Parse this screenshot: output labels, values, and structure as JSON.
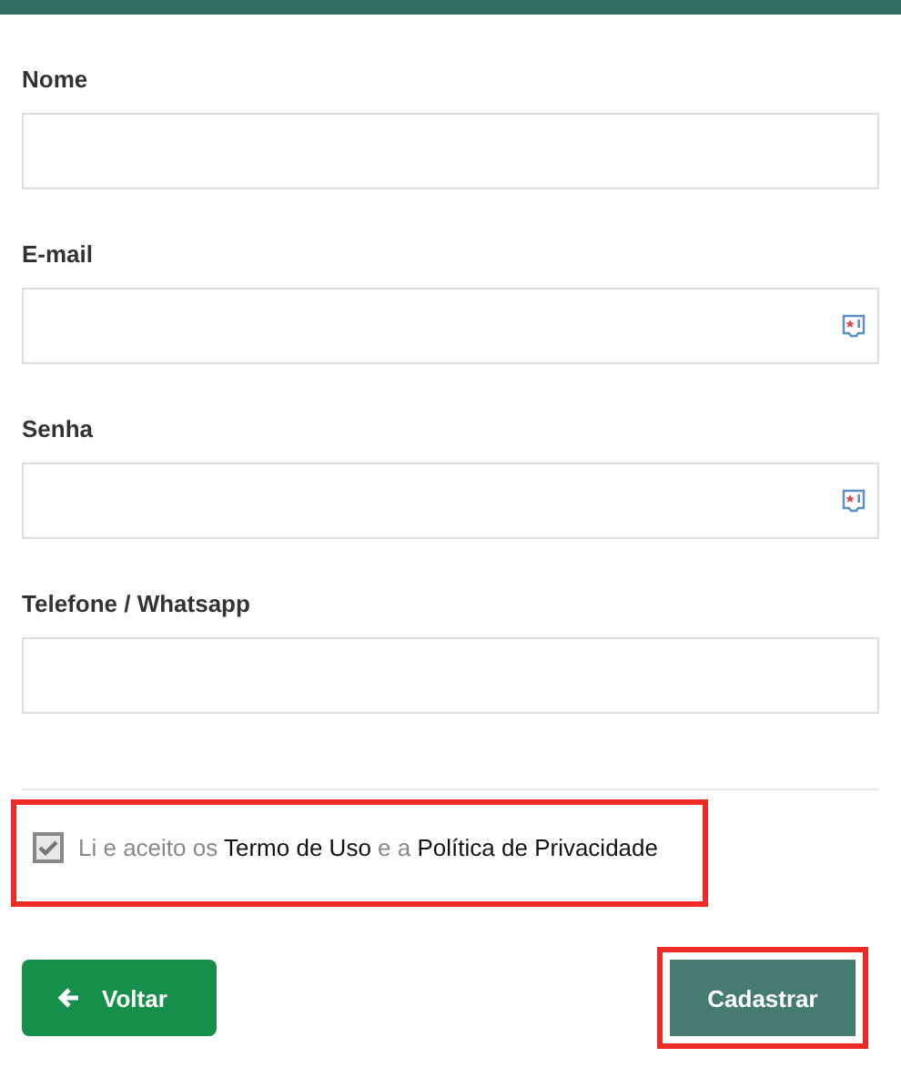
{
  "fields": [
    {
      "label": "Nome",
      "kind": "plain"
    },
    {
      "label": "E-mail",
      "kind": "autofill"
    },
    {
      "label": "Senha",
      "kind": "autofill"
    },
    {
      "label": "Telefone / Whatsapp",
      "kind": "plain"
    }
  ],
  "agreement": {
    "checked": true,
    "highlighted": true,
    "parts": [
      {
        "text": "Li e aceito os",
        "kind": "plain"
      },
      {
        "text": "Termo de Uso",
        "kind": "link"
      },
      {
        "text": "e a",
        "kind": "plain"
      },
      {
        "text": "Política de Privacidade",
        "kind": "link"
      }
    ]
  },
  "back_button": {
    "label": "Voltar"
  },
  "submit_button": {
    "label": "Cadastrar",
    "highlighted": true
  }
}
